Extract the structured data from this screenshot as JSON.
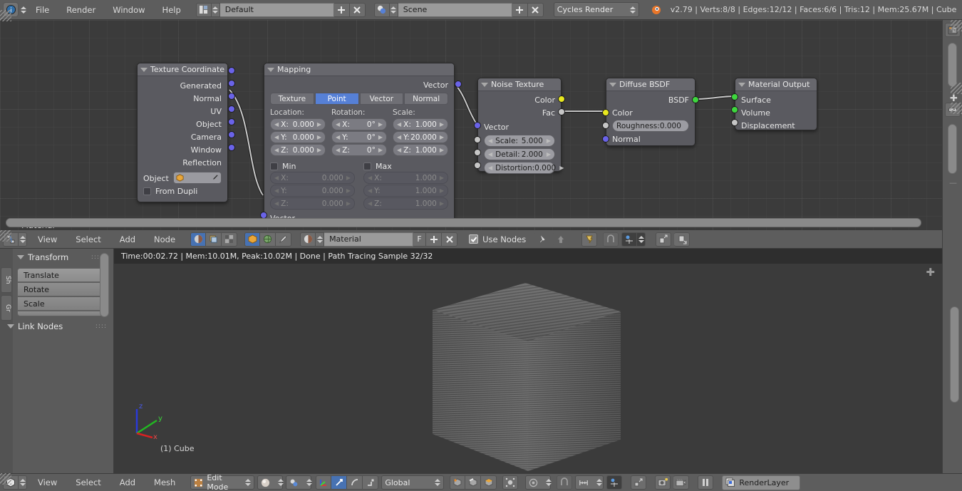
{
  "app": {
    "version_info": "v2.79 | Verts:8/8 | Edges:12/12 | Faces:6/6 | Tris:12 | Mem:25.67M | Cube",
    "menus": [
      "File",
      "Render",
      "Window",
      "Help"
    ],
    "screen_layout": "Default",
    "scene": "Scene",
    "render_engine": "Cycles Render"
  },
  "node_editor": {
    "editor_label": "Material",
    "header": {
      "menus": [
        "View",
        "Select",
        "Add",
        "Node"
      ],
      "datablock": "Material",
      "fake_user_label": "F",
      "use_nodes_label": "Use Nodes",
      "new_label": "+",
      "unlink_label": "X"
    },
    "nodes": [
      {
        "title": "Texture Coordinate",
        "outputs": [
          "Generated",
          "Normal",
          "UV",
          "Object",
          "Camera",
          "Window",
          "Reflection"
        ],
        "object_label": "Object",
        "object_value": "",
        "from_dupli_label": "From Dupli"
      },
      {
        "title": "Mapping",
        "output": "Vector",
        "tabs": [
          "Texture",
          "Point",
          "Vector",
          "Normal"
        ],
        "selected_tab": "Point",
        "groups": [
          {
            "caption": "Location:",
            "fields": [
              {
                "label": "X:",
                "value": "0.000"
              },
              {
                "label": "Y:",
                "value": "0.000"
              },
              {
                "label": "Z:",
                "value": "0.000"
              }
            ]
          },
          {
            "caption": "Rotation:",
            "fields": [
              {
                "label": "X:",
                "value": "0°"
              },
              {
                "label": "Y:",
                "value": "0°"
              },
              {
                "label": "Z:",
                "value": "0°"
              }
            ]
          },
          {
            "caption": "Scale:",
            "fields": [
              {
                "label": "X:",
                "value": "1.000"
              },
              {
                "label": "Y:",
                "value": "20.000"
              },
              {
                "label": "Z:",
                "value": "1.000"
              }
            ]
          }
        ],
        "min": {
          "label": "Min",
          "checked": false,
          "fields": [
            {
              "label": "X:",
              "value": "0.000"
            },
            {
              "label": "Y:",
              "value": "0.000"
            },
            {
              "label": "Z:",
              "value": "0.000"
            }
          ]
        },
        "max": {
          "label": "Max",
          "checked": false,
          "fields": [
            {
              "label": "X:",
              "value": "1.000"
            },
            {
              "label": "Y:",
              "value": "1.000"
            },
            {
              "label": "Z:",
              "value": "1.000"
            }
          ]
        },
        "input": "Vector"
      },
      {
        "title": "Noise Texture",
        "outputs": [
          "Color",
          "Fac"
        ],
        "input_vector": "Vector",
        "params": [
          {
            "label": "Scale:",
            "value": "5.000"
          },
          {
            "label": "Detail:",
            "value": "2.000"
          },
          {
            "label": "Distortion:",
            "value": "0.000"
          }
        ]
      },
      {
        "title": "Diffuse BSDF",
        "output": "BSDF",
        "inputs": [
          "Color",
          "Normal"
        ],
        "roughness": "Roughness:0.000"
      },
      {
        "title": "Material Output",
        "inputs": [
          "Surface",
          "Volume",
          "Displacement"
        ]
      }
    ]
  },
  "tool_shelf": {
    "tabs": [
      "Sh",
      "Gr"
    ],
    "panels": [
      {
        "title": "Transform",
        "buttons": [
          "Translate",
          "Rotate",
          "Scale"
        ]
      },
      {
        "title": "Link Nodes",
        "buttons": []
      }
    ]
  },
  "viewport": {
    "render_status": "Time:00:02.72 | Mem:10.01M, Peak:10.02M | Done | Path Tracing Sample 32/32",
    "object_label": "(1) Cube",
    "axes": {
      "x": "x",
      "y": "y",
      "z": "z"
    }
  },
  "bottom_bar": {
    "menus": [
      "View",
      "Select",
      "Add",
      "Mesh"
    ],
    "mode": "Edit Mode",
    "orientation": "Global",
    "render_layer": "RenderLayer"
  },
  "colors": {
    "accent_blue": "#5680d6",
    "socket_vector": "#6a63e8",
    "socket_color": "#e8e81f",
    "socket_value": "#c6c6c6",
    "socket_shader": "#3ed63e",
    "header_gray": "#5d5d5d",
    "canvas_gray": "#3b3b3b"
  }
}
